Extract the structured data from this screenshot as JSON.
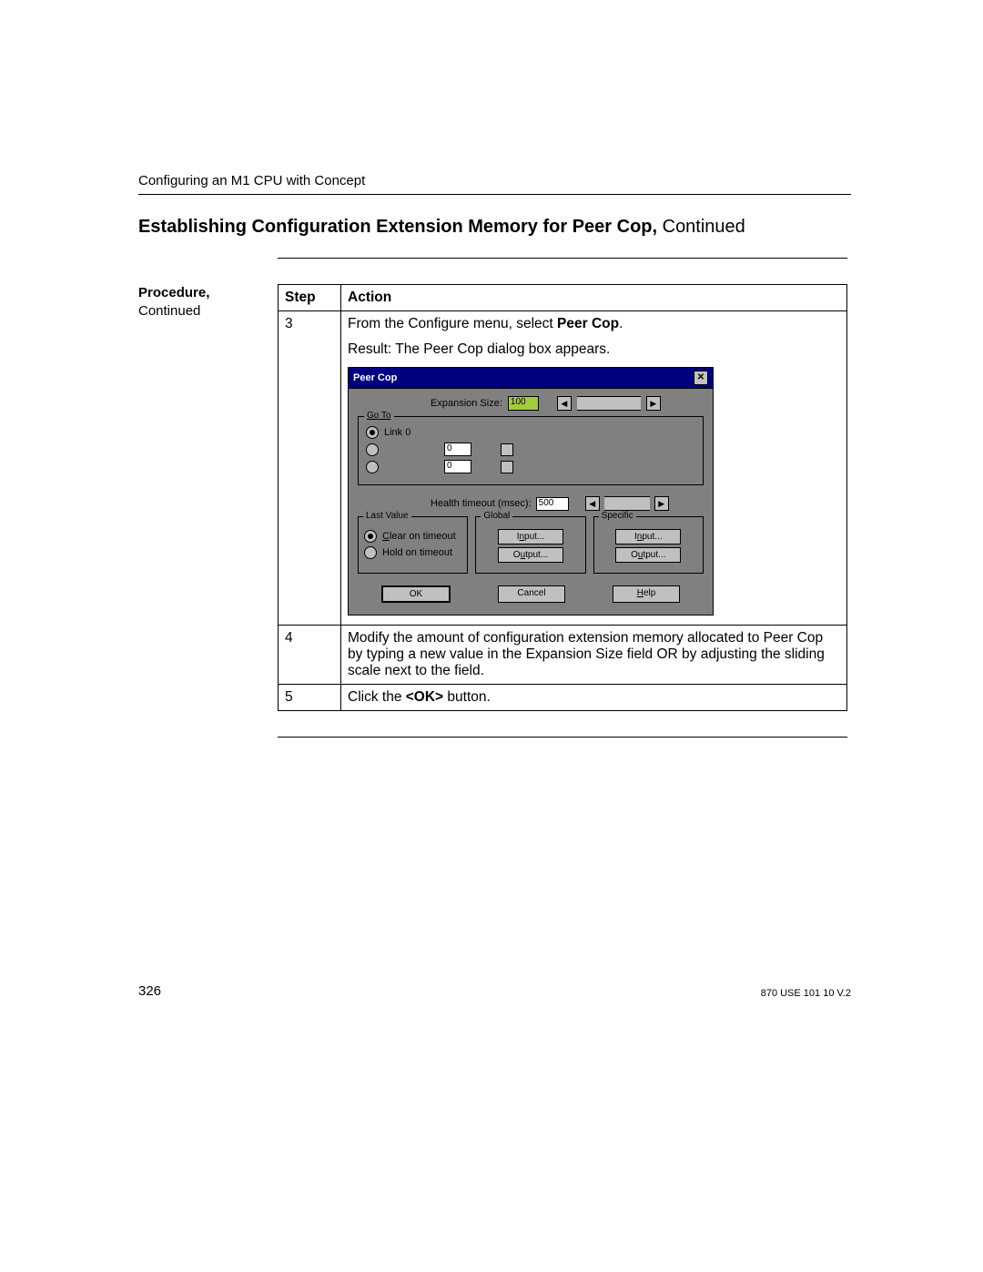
{
  "header": {
    "running": "Configuring an M1 CPU with Concept"
  },
  "title_bold": "Establishing Configuration Extension Memory for Peer Cop,",
  "title_cont": " Continued",
  "side": {
    "label_bold": "Procedure,",
    "label_cont": "Continued"
  },
  "table": {
    "head_step": "Step",
    "head_action": "Action",
    "r3_step": "3",
    "r3_line1_a": "From the Configure menu, select ",
    "r3_line1_b": "Peer Cop",
    "r3_line1_c": ".",
    "r3_line2": "Result: The Peer Cop dialog box appears.",
    "r4_step": "4",
    "r4_action": "Modify the amount of configuration extension memory allocated to Peer Cop by typing a new value in the Expansion Size field OR by adjusting the sliding scale next to the field.",
    "r5_step": "5",
    "r5_action_a": "Click the ",
    "r5_action_b": "<OK>",
    "r5_action_c": " button."
  },
  "dialog": {
    "title": "Peer Cop",
    "expansion_label": "Expansion Size:",
    "expansion_value": "100",
    "goto_legend": "Go To",
    "link0": "Link 0",
    "zero_a": "0",
    "zero_b": "0",
    "health_label": "Health timeout (msec):",
    "health_value": "500",
    "lastvalue_legend": "Last Value",
    "clear": "Clear on timeout",
    "hold": "Hold on timeout",
    "global_legend": "Global",
    "specific_legend": "Specific",
    "input_btn": "Input...",
    "output_btn": "Output...",
    "ok": "OK",
    "cancel": "Cancel",
    "help": "Help"
  },
  "footer": {
    "page": "326",
    "doc_id": "870 USE 101 10 V.2"
  }
}
